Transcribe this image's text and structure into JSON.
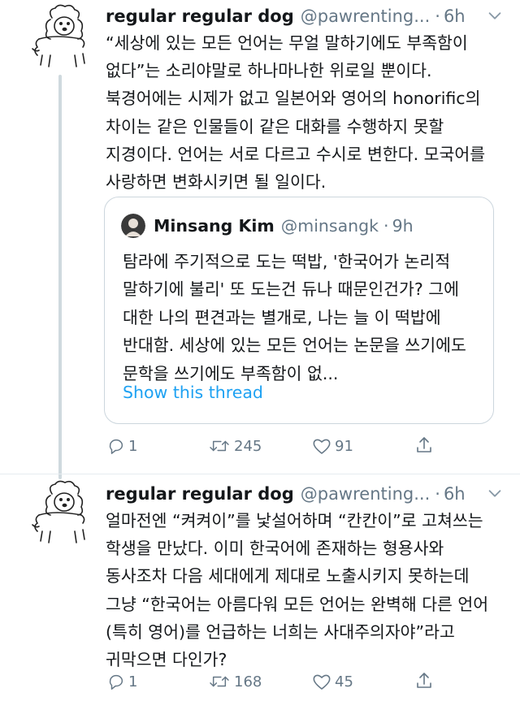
{
  "tweets": [
    {
      "name": "regular regular dog",
      "handle": "@pawrenting...",
      "dot": "·",
      "time": "6h",
      "text": "“세상에 있는 모든 언어는 무얼 말하기에도 부족함이 없다”는 소리야말로 하나마나한 위로일 뿐이다. 북경어에는 시제가 없고 일본어와 영어의 honorific의 차이는 같은 인물들이 같은 대화를 수행하지 못할 지경이다. 언어는 서로 다르고 수시로 변한다. 모국어를 사랑하면 변화시키면 될 일이다.",
      "quote": {
        "name": "Minsang Kim",
        "handle": "@minsangk",
        "dot": "·",
        "time": "9h",
        "text": "탐라에 주기적으로 도는 떡밥, '한국어가 논리적 말하기에 불리' 또 도는건 듀나 때문인건가? 그에 대한 나의 편견과는 별개로, 나는 늘 이 떡밥에 반대함. 세상에 있는 모든 언어는 논문을 쓰기에도 문학을 쓰기에도 부족함이 없...",
        "show_thread": "Show this thread"
      },
      "replies": "1",
      "retweets": "245",
      "likes": "91"
    },
    {
      "name": "regular regular dog",
      "handle": "@pawrenting...",
      "dot": "·",
      "time": "6h",
      "text": "얼마전엔 “켜켜이”를 낯설어하며 “칸칸이”로 고쳐쓰는 학생을 만났다. 이미 한국어에 존재하는 형용사와 동사조차 다음 세대에게 제대로 노출시키지 못하는데 그냥 “한국어는 아름다워 모든 언어는 완벽해 다른 언어(특히 영어)를 언급하는 너희는 사대주의자야”라고 귀막으면 다인가?",
      "replies": "1",
      "retweets": "168",
      "likes": "45"
    }
  ],
  "colors": {
    "text": "#14171a",
    "secondary": "#657786",
    "link": "#1da1f2",
    "border": "#ccd6dd"
  },
  "icons": [
    "dog-avatar",
    "chevron-down-icon",
    "reply-icon",
    "retweet-icon",
    "like-icon",
    "share-icon"
  ]
}
